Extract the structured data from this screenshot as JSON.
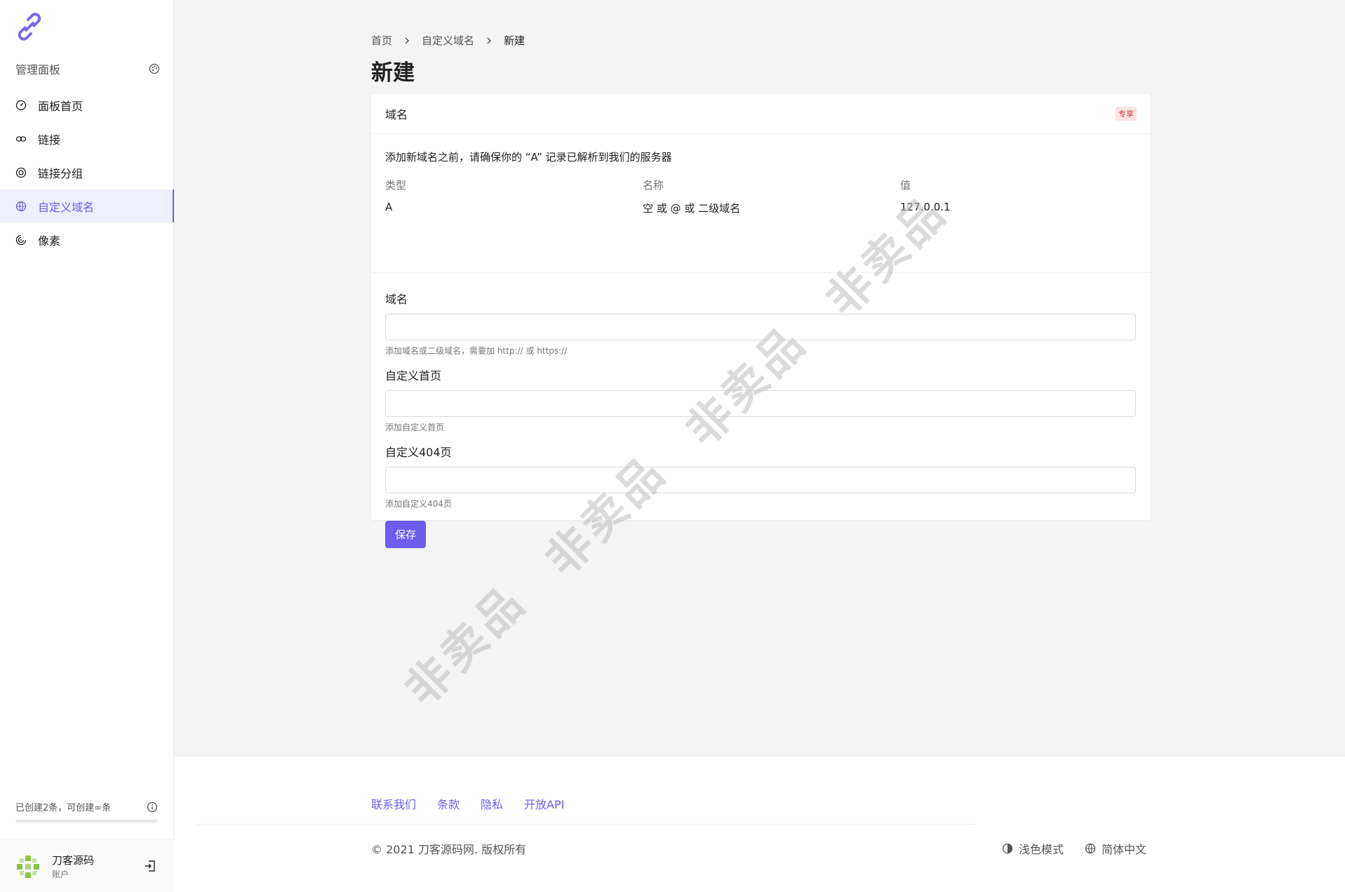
{
  "sidebar": {
    "section_title": "管理面板",
    "items": [
      {
        "label": "面板首页",
        "icon": "dashboard-icon"
      },
      {
        "label": "链接",
        "icon": "link-icon"
      },
      {
        "label": "链接分组",
        "icon": "target-icon"
      },
      {
        "label": "自定义域名",
        "icon": "globe-www-icon",
        "active": true
      },
      {
        "label": "像素",
        "icon": "radar-icon"
      }
    ],
    "usage_text": "已创建2条，可创建∞条",
    "account": {
      "name": "刀客源码",
      "subtitle": "账户"
    }
  },
  "breadcrumb": {
    "home": "首页",
    "parent": "自定义域名",
    "current": "新建"
  },
  "page_title": "新建",
  "card": {
    "title": "域名",
    "badge": "专享",
    "intro": "添加新域名之前，请确保你的 “A” 记录已解析到我们的服务器",
    "dns": {
      "headers": [
        "类型",
        "名称",
        "值"
      ],
      "values": [
        "A",
        "空 或 @ 或 二级域名",
        "127.0.0.1"
      ]
    },
    "fields": [
      {
        "label": "域名",
        "value": "",
        "hint": "添加域名或二级域名，需要加 http:// 或 https://"
      },
      {
        "label": "自定义首页",
        "value": "",
        "hint": "添加自定义首页"
      },
      {
        "label": "自定义404页",
        "value": "",
        "hint": "添加自定义404页"
      }
    ],
    "save_label": "保存"
  },
  "footer": {
    "links": [
      "联系我们",
      "条款",
      "隐私",
      "开放API"
    ],
    "copyright": "© 2021 刀客源码网. 版权所有",
    "theme_label": "浅色模式",
    "language_label": "简体中文"
  },
  "watermark": "非卖品",
  "colors": {
    "accent": "#6e5bf0",
    "badge_bg": "#fde3e3",
    "badge_text": "#d23c3c"
  }
}
